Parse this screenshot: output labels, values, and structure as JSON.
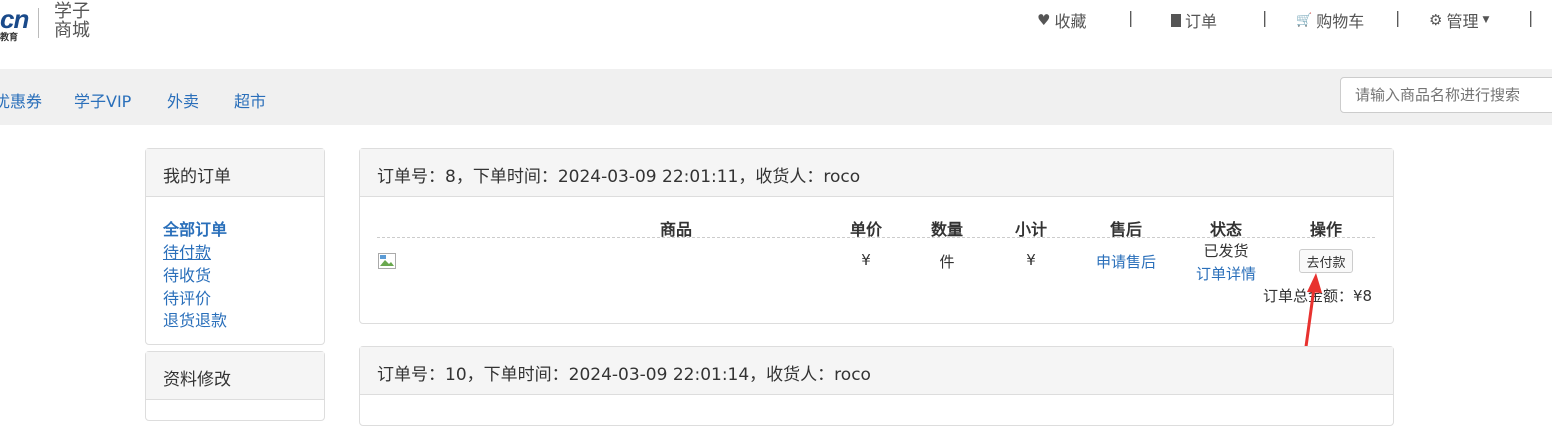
{
  "brand": {
    "mark": "cn",
    "sub": "教育",
    "name": "学子商城"
  },
  "topnav": {
    "favorites": "收藏",
    "orders": "订单",
    "cart": "购物车",
    "manage": "管理",
    "separator": "|"
  },
  "categories": [
    "优惠券",
    "学子VIP",
    "外卖",
    "超市"
  ],
  "search": {
    "placeholder": "请输入商品名称进行搜索"
  },
  "sidebar": {
    "my_orders": {
      "title": "我的订单",
      "items": [
        {
          "label": "全部订单"
        },
        {
          "label": "待付款"
        },
        {
          "label": "待收货"
        },
        {
          "label": "待评价"
        },
        {
          "label": "退货退款"
        }
      ]
    },
    "profile": {
      "title": "资料修改"
    }
  },
  "orders": [
    {
      "header": "订单号：8，下单时间：2024-03-09 22:01:11，收货人：roco",
      "columns": [
        "商品",
        "单价",
        "数量",
        "小计",
        "售后",
        "状态",
        "操作"
      ],
      "row": {
        "price": "¥",
        "qty": "件",
        "subtotal": "¥",
        "aftersale": "申请售后",
        "status": "已发货",
        "detail": "订单详情",
        "action": "去付款"
      },
      "total_label": "订单总金额：¥8"
    },
    {
      "header": "订单号：10，下单时间：2024-03-09 22:01:14，收货人：roco"
    }
  ],
  "colors": {
    "link": "#2a6fba",
    "annotation_arrow": "#e8322f"
  }
}
